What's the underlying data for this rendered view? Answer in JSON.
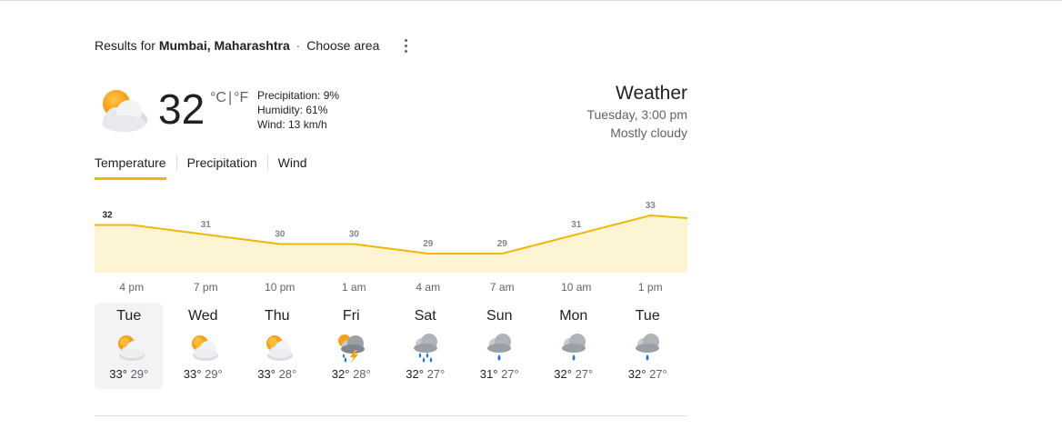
{
  "header": {
    "results_prefix": "Results for",
    "location": "Mumbai, Maharashtra",
    "separator": "·",
    "choose_area": "Choose area"
  },
  "current": {
    "temperature": "32",
    "unit_c": "°C",
    "unit_sep": "|",
    "unit_f": "°F",
    "precipitation": "Precipitation: 9%",
    "humidity": "Humidity: 61%",
    "wind": "Wind: 13 km/h",
    "icon": "partly-cloudy-icon"
  },
  "summary": {
    "title": "Weather",
    "datetime": "Tuesday, 3:00 pm",
    "condition": "Mostly cloudy"
  },
  "tabs": [
    {
      "label": "Temperature",
      "active": true
    },
    {
      "label": "Precipitation",
      "active": false
    },
    {
      "label": "Wind",
      "active": false
    }
  ],
  "chart_data": {
    "type": "area",
    "x": [
      "4 pm",
      "7 pm",
      "10 pm",
      "1 am",
      "4 am",
      "7 am",
      "10 am",
      "1 pm"
    ],
    "values": [
      32,
      31,
      30,
      30,
      29,
      29,
      31,
      33
    ],
    "labels": [
      "32",
      "31",
      "30",
      "30",
      "29",
      "29",
      "31",
      "33"
    ],
    "color_line": "#f2b705",
    "color_fill": "#fdf4d3"
  },
  "forecast": [
    {
      "day": "Tue",
      "high": "33°",
      "low": "29°",
      "icon": "partly-cloudy-icon",
      "selected": true
    },
    {
      "day": "Wed",
      "high": "33°",
      "low": "29°",
      "icon": "partly-cloudy-icon",
      "selected": false
    },
    {
      "day": "Thu",
      "high": "33°",
      "low": "28°",
      "icon": "partly-cloudy-icon",
      "selected": false
    },
    {
      "day": "Fri",
      "high": "32°",
      "low": "28°",
      "icon": "thunderstorm-icon",
      "selected": false
    },
    {
      "day": "Sat",
      "high": "32°",
      "low": "27°",
      "icon": "heavy-rain-icon",
      "selected": false
    },
    {
      "day": "Sun",
      "high": "31°",
      "low": "27°",
      "icon": "rain-icon",
      "selected": false
    },
    {
      "day": "Mon",
      "high": "32°",
      "low": "27°",
      "icon": "rain-icon",
      "selected": false
    },
    {
      "day": "Tue",
      "high": "32°",
      "low": "27°",
      "icon": "rain-icon",
      "selected": false
    }
  ]
}
